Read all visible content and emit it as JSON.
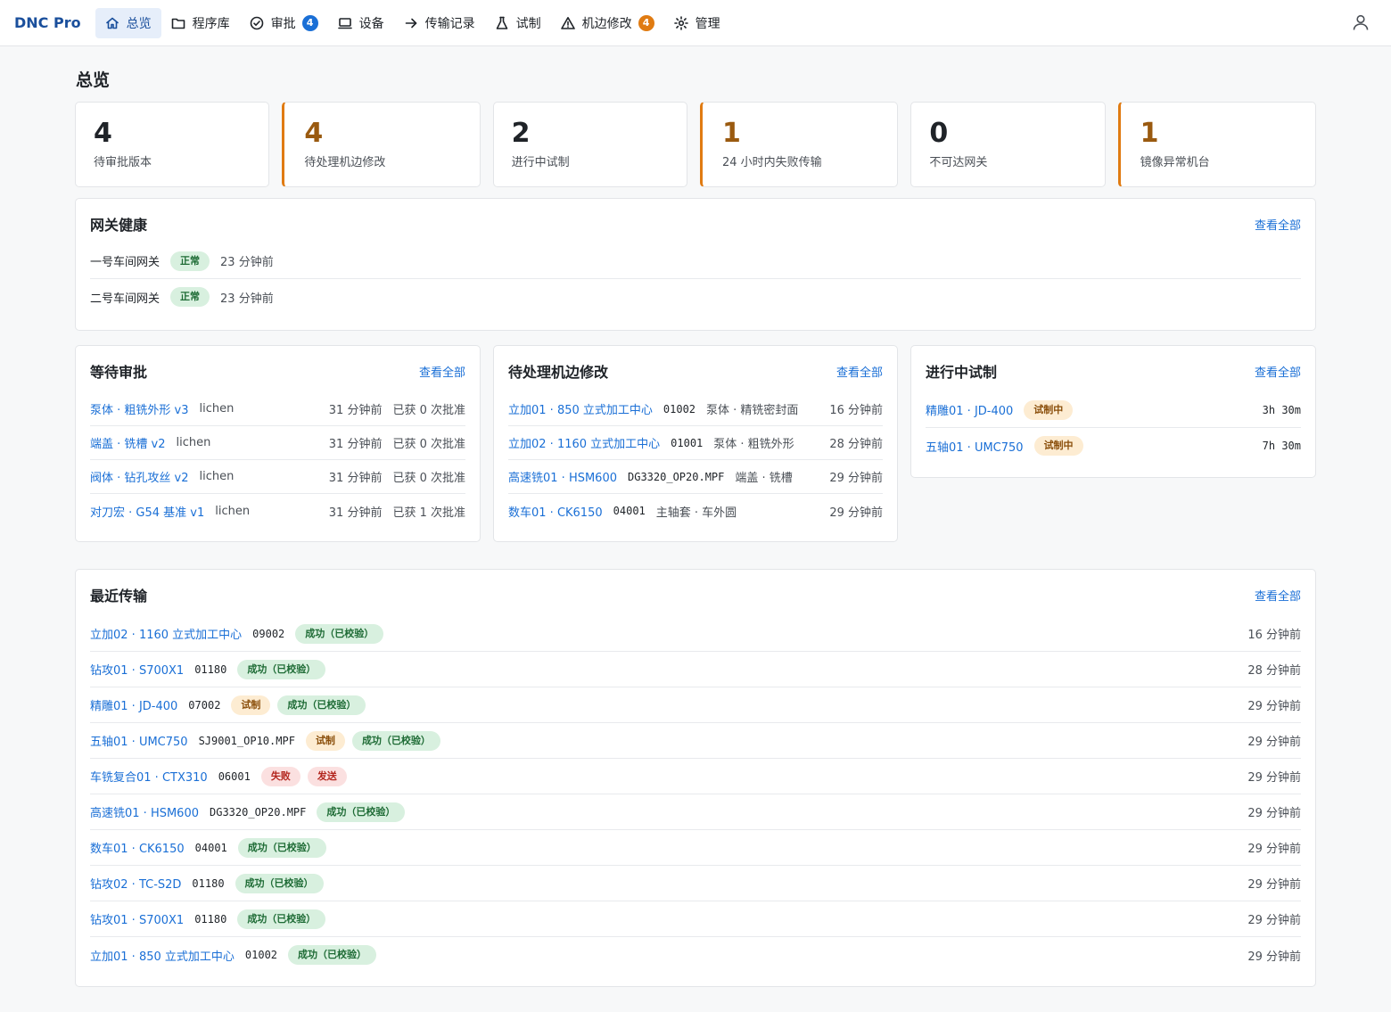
{
  "app": {
    "brand": "DNC Pro"
  },
  "nav": {
    "items": [
      {
        "label": "总览",
        "icon": "home-icon"
      },
      {
        "label": "程序库",
        "icon": "folder-icon"
      },
      {
        "label": "审批",
        "icon": "check-circle-icon",
        "badge": "4"
      },
      {
        "label": "设备",
        "icon": "monitor-icon"
      },
      {
        "label": "传输记录",
        "icon": "arrow-right-icon"
      },
      {
        "label": "试制",
        "icon": "flask-icon"
      },
      {
        "label": "机边修改",
        "icon": "warning-icon",
        "badge": "4"
      },
      {
        "label": "管理",
        "icon": "gear-icon"
      }
    ],
    "active": "总览",
    "user_icon": "user-icon"
  },
  "page": {
    "title": "总览"
  },
  "stats": [
    {
      "value": "4",
      "label": "待审批版本",
      "tone": "normal"
    },
    {
      "value": "4",
      "label": "待处理机边修改",
      "tone": "warn"
    },
    {
      "value": "2",
      "label": "进行中试制",
      "tone": "normal"
    },
    {
      "value": "1",
      "label": "24 小时内失败传输",
      "tone": "warn"
    },
    {
      "value": "0",
      "label": "不可达网关",
      "tone": "normal"
    },
    {
      "value": "1",
      "label": "镜像异常机台",
      "tone": "warn"
    }
  ],
  "gateway": {
    "title": "网关健康",
    "link": "查看全部",
    "rows": [
      {
        "name": "一号车间网关",
        "status": "正常",
        "time": "23 分钟前"
      },
      {
        "name": "二号车间网关",
        "status": "正常",
        "time": "23 分钟前"
      }
    ]
  },
  "approvals": {
    "title": "等待审批",
    "link": "查看全部",
    "rows": [
      {
        "program": "泵体 · 粗铣外形 v3",
        "user": "lichen",
        "time": "31 分钟前",
        "count": "已获 0 次批准"
      },
      {
        "program": "端盖 · 铣槽 v2",
        "user": "lichen",
        "time": "31 分钟前",
        "count": "已获 0 次批准"
      },
      {
        "program": "阀体 · 钻孔攻丝 v2",
        "user": "lichen",
        "time": "31 分钟前",
        "count": "已获 0 次批准"
      },
      {
        "program": "对刀宏 · G54 基准 v1",
        "user": "lichen",
        "time": "31 分钟前",
        "count": "已获 1 次批准"
      }
    ]
  },
  "edits": {
    "title": "待处理机边修改",
    "link": "查看全部",
    "rows": [
      {
        "machine": "立加01 · 850 立式加工中心",
        "code": "01002",
        "desc": "泵体 · 精铣密封面",
        "time": "16 分钟前"
      },
      {
        "machine": "立加02 · 1160 立式加工中心",
        "code": "01001",
        "desc": "泵体 · 粗铣外形",
        "time": "28 分钟前"
      },
      {
        "machine": "高速铣01 · HSM600",
        "code": "DG3320_OP20.MPF",
        "desc": "端盖 · 铣槽",
        "time": "29 分钟前"
      },
      {
        "machine": "数车01 · CK6150",
        "code": "04001",
        "desc": "主轴套 · 车外圆",
        "time": "29 分钟前"
      }
    ]
  },
  "trials": {
    "title": "进行中试制",
    "link": "查看全部",
    "rows": [
      {
        "machine": "精雕01 · JD-400",
        "status": "试制中",
        "duration": "3h 30m"
      },
      {
        "machine": "五轴01 · UMC750",
        "status": "试制中",
        "duration": "7h 30m"
      }
    ]
  },
  "transfers": {
    "title": "最近传输",
    "link": "查看全部",
    "rows": [
      {
        "machine": "立加02 · 1160 立式加工中心",
        "code": "09002",
        "tags": [
          {
            "text": "成功（已校验）",
            "tone": "ok"
          }
        ],
        "time": "16 分钟前"
      },
      {
        "machine": "钻攻01 · S700X1",
        "code": "01180",
        "tags": [
          {
            "text": "成功（已校验）",
            "tone": "ok"
          }
        ],
        "time": "28 分钟前"
      },
      {
        "machine": "精雕01 · JD-400",
        "code": "07002",
        "tags": [
          {
            "text": "试制",
            "tone": "trial"
          },
          {
            "text": "成功（已校验）",
            "tone": "ok"
          }
        ],
        "time": "29 分钟前"
      },
      {
        "machine": "五轴01 · UMC750",
        "code": "SJ9001_OP10.MPF",
        "tags": [
          {
            "text": "试制",
            "tone": "trial"
          },
          {
            "text": "成功（已校验）",
            "tone": "ok"
          }
        ],
        "time": "29 分钟前"
      },
      {
        "machine": "车铣复合01 · CTX310",
        "code": "06001",
        "tags": [
          {
            "text": "失败",
            "tone": "fail"
          },
          {
            "text": "发送",
            "tone": "fail"
          }
        ],
        "time": "29 分钟前"
      },
      {
        "machine": "高速铣01 · HSM600",
        "code": "DG3320_OP20.MPF",
        "tags": [
          {
            "text": "成功（已校验）",
            "tone": "ok"
          }
        ],
        "time": "29 分钟前"
      },
      {
        "machine": "数车01 · CK6150",
        "code": "04001",
        "tags": [
          {
            "text": "成功（已校验）",
            "tone": "ok"
          }
        ],
        "time": "29 分钟前"
      },
      {
        "machine": "钻攻02 · TC-S2D",
        "code": "01180",
        "tags": [
          {
            "text": "成功（已校验）",
            "tone": "ok"
          }
        ],
        "time": "29 分钟前"
      },
      {
        "machine": "钻攻01 · S700X1",
        "code": "01180",
        "tags": [
          {
            "text": "成功（已校验）",
            "tone": "ok"
          }
        ],
        "time": "29 分钟前"
      },
      {
        "machine": "立加01 · 850 立式加工中心",
        "code": "01002",
        "tags": [
          {
            "text": "成功（已校验）",
            "tone": "ok"
          }
        ],
        "time": "29 分钟前"
      }
    ]
  }
}
